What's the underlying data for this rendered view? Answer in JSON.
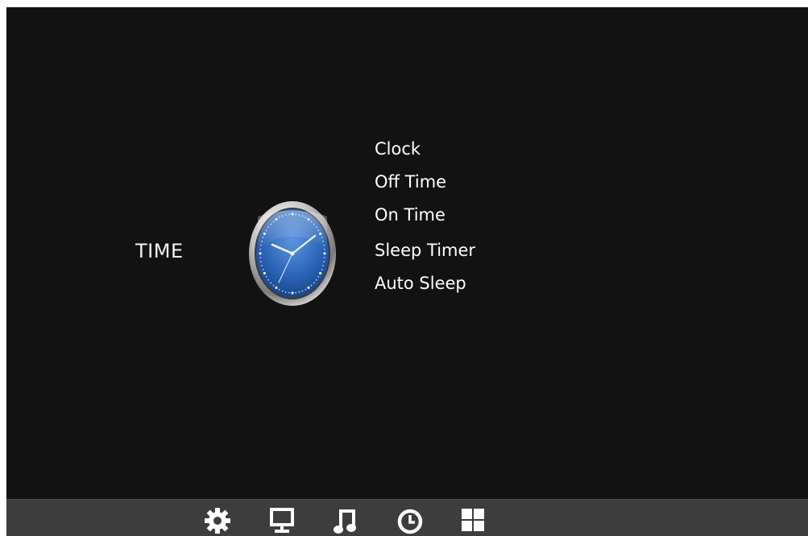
{
  "screen": {
    "section_title": "TIME",
    "section_icon": "analog-clock-icon"
  },
  "menu": {
    "items": [
      {
        "label": "Clock"
      },
      {
        "label": "Off Time"
      },
      {
        "label": "On Time"
      },
      {
        "label": "Sleep Timer"
      },
      {
        "label": "Auto Sleep"
      }
    ]
  },
  "bottom_bar": {
    "icons": [
      {
        "name": "settings-gear-icon"
      },
      {
        "name": "monitor-icon"
      },
      {
        "name": "music-note-icon"
      },
      {
        "name": "clock-icon",
        "selected": true
      },
      {
        "name": "grid-icon"
      }
    ]
  },
  "colors": {
    "background": "#121212",
    "text": "#ffffff",
    "bar": "#3d3d3d",
    "clock_face": "#2f6fc4"
  }
}
